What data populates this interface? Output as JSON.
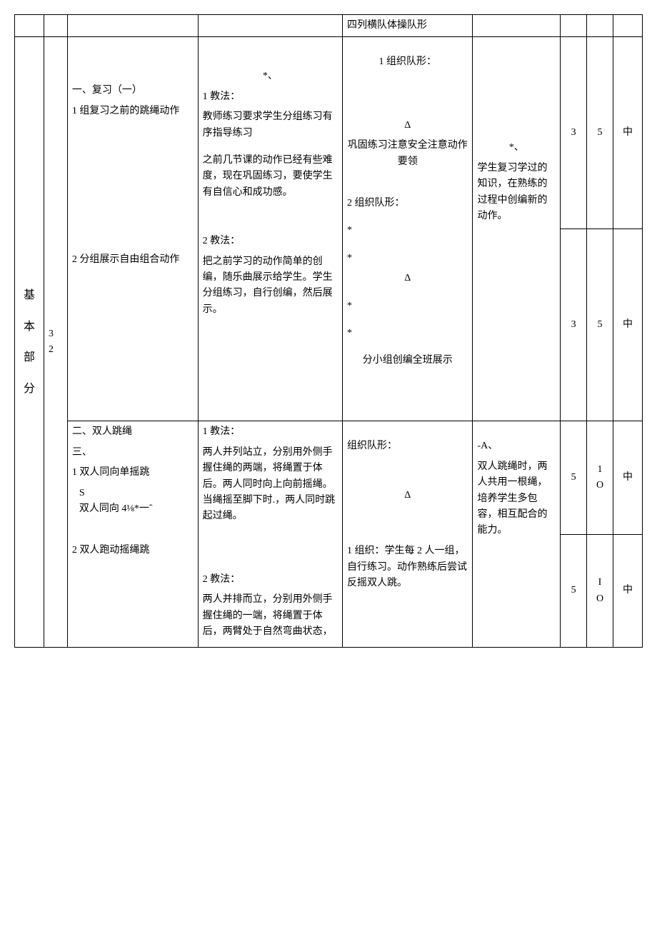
{
  "row0": {
    "org": "四列横队体操队形"
  },
  "section_label": "基本部分",
  "section_num": "3\n2",
  "row1": {
    "content_title": "一、复习（一）",
    "content_item1": "1 组复习之前的跳绳动作",
    "content_item2": "2 分组展示自由组合动作",
    "method_star": "*、",
    "method_title1": "1 教法：",
    "method_body1a": "教师练习要求学生分组练习有序指导练习",
    "method_body1b": "之前几节课的动作已经有些难度，现在巩固练习，要使学生有自信心和成功感。",
    "method_title2": "2 教法：",
    "method_body2": "把之前学习的动作简单的创编，随乐曲展示给学生。学生分组练习，自行创编，然后展示。",
    "org_title1": "1 组织队形：",
    "org_symbol1": "Δ",
    "org_note1": "巩固练习注意安全注意动作要领",
    "org_title2": "2 组织队形：",
    "org_star": "*",
    "org_symbol2": "Δ",
    "org_note2": "分小组创编全班展示",
    "learn_star": "*、",
    "learn_body": "学生复习学过的知识，在熟练的过程中创编新的动作。",
    "n1_a": "3",
    "n2_a": "5",
    "n3_a": "中",
    "n1_b": "3",
    "n2_b": "5",
    "n3_b": "中"
  },
  "row2": {
    "content_title": "二、双人跳绳",
    "content_sub": "三、",
    "content_item1": "1 双人同向单摇跳",
    "content_extra": "S\n双人同向 4⅛*一ˆ",
    "content_item2": "2 双人跑动摇绳跳",
    "method_title1": "1 教法：",
    "method_body1": "两人并列站立，分别用外侧手握住绳的两端，将绳置于体后。两人同时向上向前摇绳。当绳摇至脚下时.，两人同时跳起过绳。",
    "method_title2": "2 教法：",
    "method_body2": "两人并排而立，分别用外侧手握住绳的一端，将绳置于体后，两臂处于自然弯曲状态，",
    "org_title": "组织队形：",
    "org_symbol": "Δ",
    "org_group": "1 组织：学生每 2 人一组，自行练习。动作熟练后尝试反摇双人跳。",
    "learn_prefix": "-A、",
    "learn_body": "双人跳绳时，两人共用一根绳，培养学生多包容，相互配合的能力。",
    "n1_a": "5",
    "n2_a": "1\nO",
    "n3_a": "中",
    "n1_b": "5",
    "n2_b": "I\nO",
    "n3_b": "中"
  }
}
